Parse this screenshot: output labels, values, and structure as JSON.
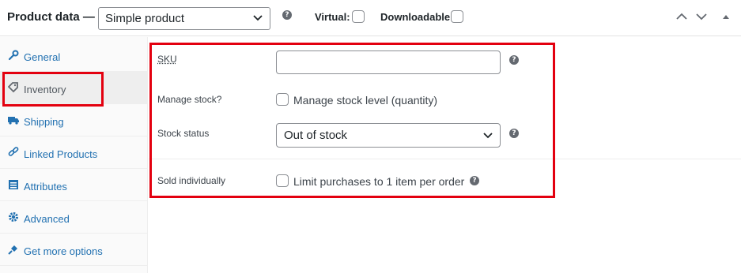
{
  "header": {
    "title": "Product data —",
    "product_type": "Simple product",
    "virtual_label": "Virtual:",
    "downloadable_label": "Downloadable:"
  },
  "sidebar": {
    "items": [
      {
        "label": "General",
        "icon": "wrench-icon"
      },
      {
        "label": "Inventory",
        "icon": "tag-icon"
      },
      {
        "label": "Shipping",
        "icon": "truck-icon"
      },
      {
        "label": "Linked Products",
        "icon": "link-icon"
      },
      {
        "label": "Attributes",
        "icon": "list-icon"
      },
      {
        "label": "Advanced",
        "icon": "gear-icon"
      },
      {
        "label": "Get more options",
        "icon": "plugin-icon"
      }
    ],
    "active_index": 1
  },
  "inventory": {
    "sku_label": "SKU",
    "sku_value": "",
    "manage_stock_label": "Manage stock?",
    "manage_stock_checkbox_label": "Manage stock level (quantity)",
    "stock_status_label": "Stock status",
    "stock_status_value": "Out of stock",
    "sold_individually_label": "Sold individually",
    "sold_individually_checkbox_label": "Limit purchases to 1 item per order"
  },
  "colors": {
    "link": "#2271b1",
    "highlight": "#e3000f",
    "text": "#1d2327"
  }
}
